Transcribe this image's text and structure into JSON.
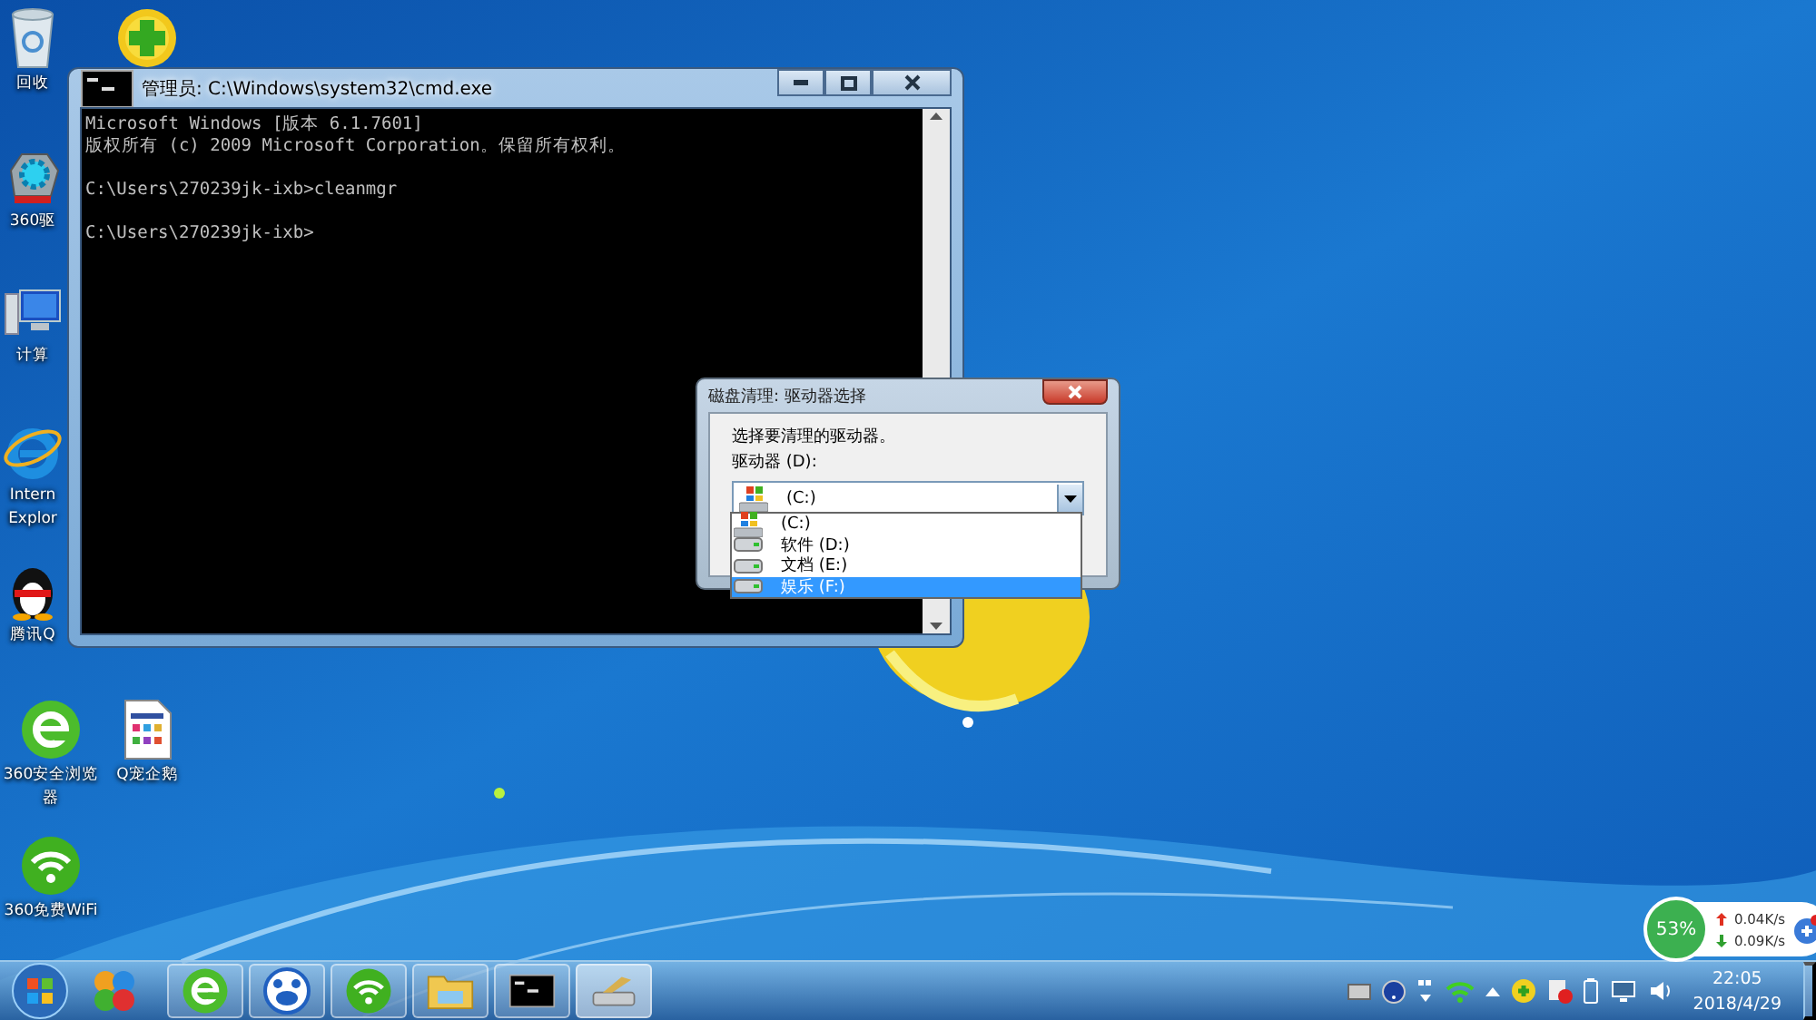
{
  "desktop_icons": [
    {
      "kind": "trash",
      "label": "回收"
    },
    {
      "kind": "plus"
    },
    {
      "kind": "gear",
      "label": "360驱"
    },
    {
      "kind": "computer",
      "label": "计算"
    },
    {
      "kind": "orbit",
      "label": "Intern\nExplor"
    },
    {
      "kind": "penguin",
      "label": "腾讯Q"
    },
    {
      "kind": "browser",
      "label": "360安全浏览器"
    },
    {
      "kind": "document",
      "label": "Q宠企鹅"
    },
    {
      "kind": "wifi",
      "label": "360免费WiFi"
    }
  ],
  "cmd_window": {
    "title": "管理员: C:\\Windows\\system32\\cmd.exe",
    "blocks": [
      [
        "Microsoft Windows [版本 6.1.7601]",
        "版权所有 (c) 2009 Microsoft Corporation。保留所有权利。"
      ],
      [
        "C:\\Users\\270239jk-ixb>cleanmgr"
      ],
      [
        "C:\\Users\\270239jk-ixb>"
      ]
    ]
  },
  "dialog": {
    "title": "磁盘清理: 驱动器选择",
    "prompt": "选择要清理的驱动器。",
    "field_label": "驱动器 (D):",
    "value": "(C:)",
    "options": [
      {
        "label": "(C:)",
        "kind": "system",
        "highlighted": false
      },
      {
        "label": "软件 (D:)",
        "kind": "drive",
        "highlighted": false
      },
      {
        "label": "文档 (E:)",
        "kind": "drive",
        "highlighted": false
      },
      {
        "label": "娱乐 (F:)",
        "kind": "drive",
        "highlighted": true
      }
    ]
  },
  "speed_widget": {
    "percent": "53%",
    "upload": "0.04K/s",
    "download": "0.09K/s"
  },
  "taskbar": {
    "pinned": [
      {
        "kind": "browser",
        "selected": false
      },
      {
        "kind": "paw",
        "selected": false
      },
      {
        "kind": "wifi",
        "selected": false
      },
      {
        "kind": "folder",
        "selected": false
      },
      {
        "kind": "console",
        "selected": false
      },
      {
        "kind": "cleanup",
        "selected": true
      }
    ],
    "clock": {
      "time": "22:05",
      "date": "2018/4/29"
    }
  }
}
